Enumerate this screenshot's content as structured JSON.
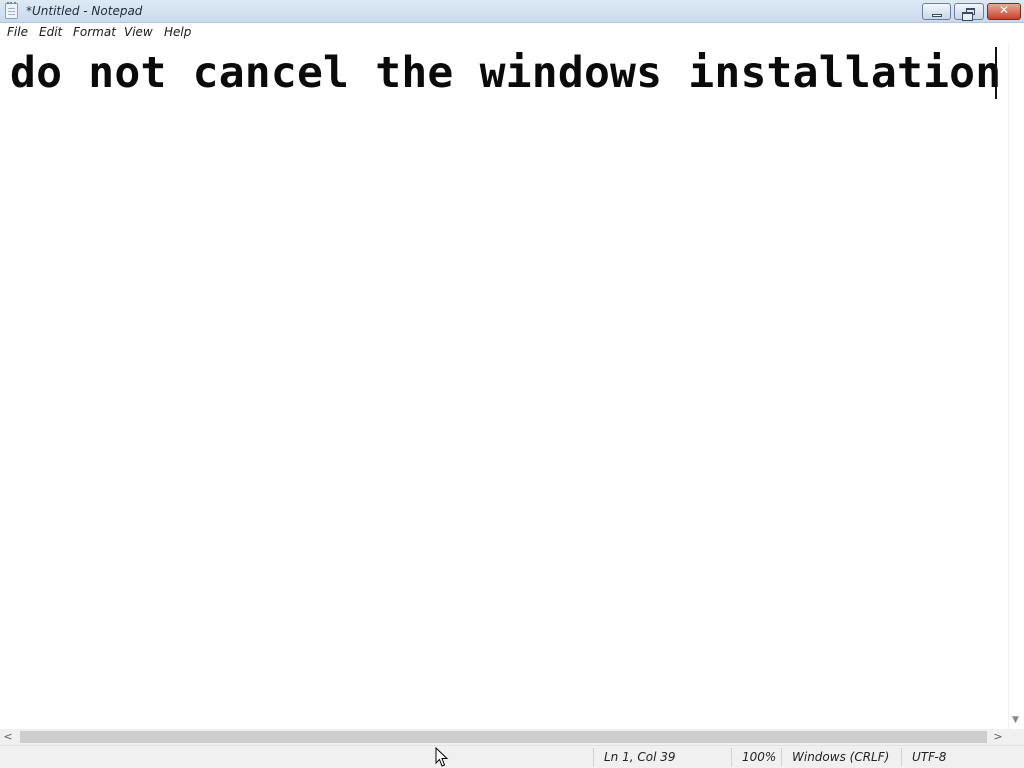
{
  "window": {
    "title": "*Untitled - Notepad",
    "close_glyph": "✕"
  },
  "menu": {
    "items": [
      {
        "label": "File"
      },
      {
        "label": "Edit"
      },
      {
        "label": "Format"
      },
      {
        "label": "View"
      },
      {
        "label": "Help"
      }
    ]
  },
  "editor": {
    "content": "do not cancel the windows installation"
  },
  "scrollbars": {
    "left_arrow": "<",
    "right_arrow": ">",
    "down_arrow": "▼"
  },
  "status": {
    "position": "Ln 1, Col 39",
    "zoom": "100%",
    "line_ending": "Windows (CRLF)",
    "encoding": "UTF-8"
  },
  "icons": {
    "app": "notepad-icon",
    "minimize": "minimize-icon",
    "maximize": "restore-icon",
    "close": "close-icon",
    "pointer": "mouse-pointer-icon"
  },
  "colors": {
    "titlebar": "#c9daee",
    "close_button": "#c7402b",
    "status_bar": "#f0f0f0"
  }
}
